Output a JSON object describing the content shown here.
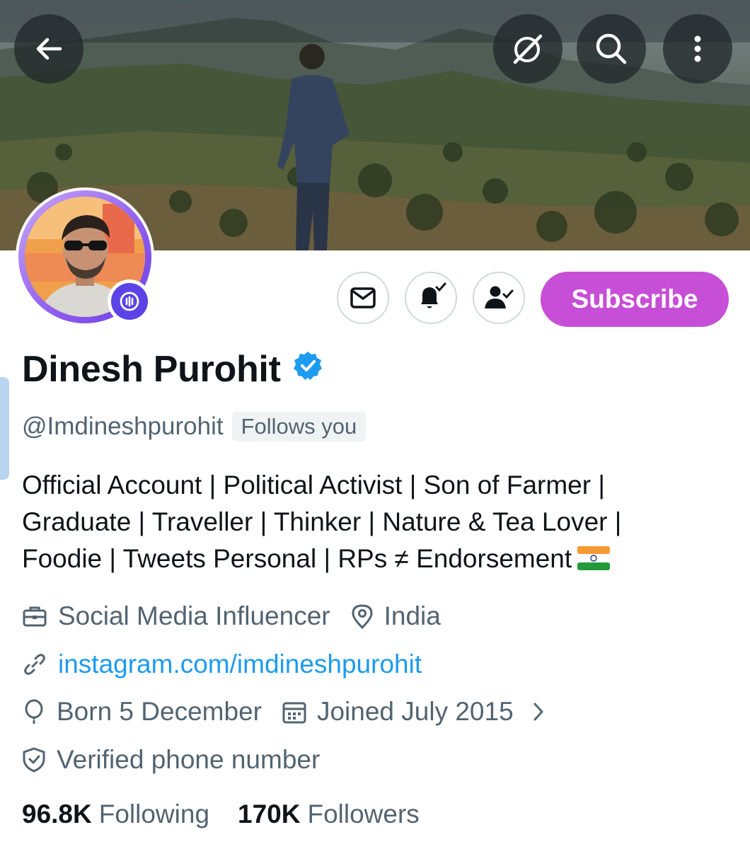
{
  "header": {
    "back_icon": "arrow-left-icon",
    "grok_icon": "grok-icon",
    "search_icon": "search-icon",
    "more_icon": "more-vertical-icon"
  },
  "profile": {
    "name": "Dinesh Purohit",
    "handle": "@Imdineshpurohit",
    "follows_you": "Follows you",
    "verified": true,
    "bio_lines": [
      "Official Account | Political Activist | Son of Farmer |",
      "Graduate | Traveller | Thinker | Nature & Tea Lover |",
      "Foodie | Tweets Personal | RPs ≠ Endorsement"
    ],
    "profession": "Social Media Influencer",
    "location": "India",
    "website": "instagram.com/imdineshpurohit",
    "birthday": "Born 5 December",
    "joined": "Joined July 2015",
    "verified_phone": "Verified phone number"
  },
  "actions": {
    "message_icon": "envelope-icon",
    "notifications_icon": "bell-check-icon",
    "following_icon": "person-check-icon",
    "subscribe_label": "Subscribe"
  },
  "stats": {
    "following_count": "96.8K",
    "following_label": "Following",
    "followers_count": "170K",
    "followers_label": "Followers"
  },
  "colors": {
    "accent_blue": "#1d9bf0",
    "subscribe": "#c74ed6",
    "secondary_text": "#536471",
    "primary_text": "#0f1419"
  }
}
